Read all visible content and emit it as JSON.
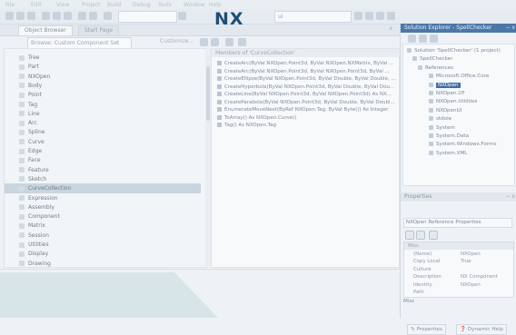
{
  "brand": {
    "logo_text": "NX"
  },
  "menubar": {
    "items": [
      "File",
      "Edit",
      "View",
      "Project",
      "Build",
      "Debug",
      "Tools",
      "Window",
      "Help"
    ]
  },
  "toolbar": {
    "combo_text": "ui"
  },
  "tabs": [
    "Object Browser",
    "Start Page"
  ],
  "object_browser": {
    "browse_combo": "Browse: Custom Component Set",
    "customize_label": "Customize...",
    "members_header": "Members of 'CurveCollection'",
    "tree_items": [
      "Tree",
      "Part",
      "NXOpen",
      "Body",
      "Point",
      "Tag",
      "Line",
      "Arc",
      "Spline",
      "Curve",
      "Edge",
      "Face",
      "Feature",
      "Sketch",
      "CurveCollection",
      "Expression",
      "Assembly",
      "Component",
      "Matrix",
      "Session",
      "Utilities",
      "Display",
      "Drawing"
    ],
    "selected_tree_index": 14,
    "members": [
      "CreateArc(ByVal NXOpen.Point3d, ByVal NXOpen.NXMatrix, ByVal ...",
      "CreateArc(ByVal NXOpen.Point3d, ByVal NXOpen.Point3d, ByVal ...",
      "CreateEllipse(ByVal NXOpen.Point3d, ByVal Double, ByVal Double, ...",
      "CreateHyperbola(ByVal NXOpen.Point3d, ByVal Double, ByVal Dou...",
      "CreateLine(ByVal NXOpen.Point3d, ByVal NXOpen.Point3d) As NX...",
      "CreateParabola(ByVal NXOpen.Point3d, ByVal Double, ByVal Doubl...",
      "EnumerateMoveNext(ByRef NXOpen.Tag, ByVal Byte()) As Integer",
      "ToArray() As NXOpen.Curve()",
      "Tag() As NXOpen.Tag"
    ]
  },
  "solution_explorer": {
    "title": "Solution Explorer - SpellChecker",
    "solution_label": "Solution 'SpellChecker' (1 project)",
    "project_label": "SpellChecker",
    "references_label": "References",
    "references": [
      "Microsoft.Office.Core",
      "NXOpen",
      "NXOpen.UF",
      "NXOpen.Utilities",
      "NXOpenUI",
      "stdole",
      "System",
      "System.Data",
      "System.Windows.Forms",
      "System.XML"
    ],
    "selected_reference": "NXOpen"
  },
  "properties": {
    "title": "Properties",
    "object_combo": "NXOpen  Reference Properties",
    "rows": [
      {
        "category": true,
        "key": "Misc",
        "value": ""
      },
      {
        "key": "(Name)",
        "value": "NXOpen"
      },
      {
        "key": "Copy Local",
        "value": "True"
      },
      {
        "key": "Culture",
        "value": ""
      },
      {
        "key": "Description",
        "value": "NX Component"
      },
      {
        "key": "Identity",
        "value": "NXOpen"
      },
      {
        "key": "Path",
        "value": ""
      }
    ],
    "description": "Misc"
  },
  "bottom_tabs": [
    "Properties",
    "Dynamic Help"
  ]
}
